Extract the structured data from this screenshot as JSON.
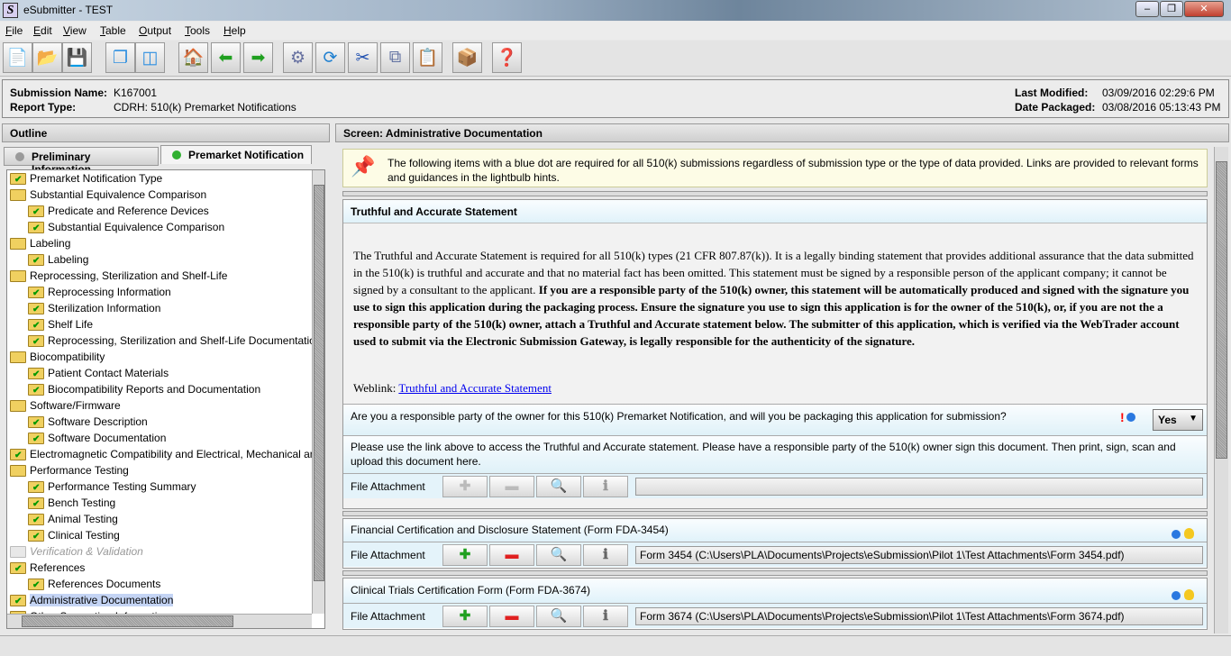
{
  "window": {
    "title": "eSubmitter - TEST",
    "icon_letter": "S"
  },
  "menu": [
    "File",
    "Edit",
    "View",
    "Table",
    "Output",
    "Tools",
    "Help"
  ],
  "toolbar": [
    "new-document-icon",
    "open-folder-icon",
    "save-icon",
    "cascade-windows-icon",
    "tile-windows-icon",
    "home-icon",
    "back-arrow-icon",
    "forward-arrow-icon",
    "gears-run-icon",
    "refresh-icon",
    "cut-icon",
    "copy-icon",
    "paste-icon",
    "package-icon",
    "help-icon"
  ],
  "info": {
    "submission_name_label": "Submission Name:",
    "submission_name": "K167001",
    "report_type_label": "Report Type:",
    "report_type": "CDRH: 510(k) Premarket Notifications",
    "last_modified_label": "Last Modified:",
    "last_modified": "03/09/2016 02:29:6 PM",
    "date_packaged_label": "Date Packaged:",
    "date_packaged": "03/08/2016 05:13:43 PM"
  },
  "outline": {
    "title": "Outline",
    "tabs": [
      {
        "label": "Preliminary Information",
        "color": "#9a9a9a"
      },
      {
        "label": "Premarket Notification",
        "color": "#30b030"
      }
    ],
    "tree": [
      {
        "label": "Premarket Notification Type",
        "level": 0
      },
      {
        "label": "Substantial Equivalence Comparison",
        "level": 0,
        "nocheck": true
      },
      {
        "label": "Predicate and Reference Devices",
        "level": 1
      },
      {
        "label": "Substantial Equivalence Comparison",
        "level": 1
      },
      {
        "label": "Labeling",
        "level": 0,
        "nocheck": true
      },
      {
        "label": "Labeling",
        "level": 1
      },
      {
        "label": "Reprocessing, Sterilization and Shelf-Life",
        "level": 0,
        "nocheck": true
      },
      {
        "label": "Reprocessing Information",
        "level": 1
      },
      {
        "label": "Sterilization Information",
        "level": 1
      },
      {
        "label": "Shelf Life",
        "level": 1
      },
      {
        "label": "Reprocessing, Sterilization and Shelf-Life Documentation",
        "level": 1
      },
      {
        "label": "Biocompatibility",
        "level": 0,
        "nocheck": true
      },
      {
        "label": "Patient Contact Materials",
        "level": 1
      },
      {
        "label": "Biocompatibility Reports and Documentation",
        "level": 1
      },
      {
        "label": "Software/Firmware",
        "level": 0,
        "nocheck": true
      },
      {
        "label": "Software Description",
        "level": 1
      },
      {
        "label": "Software Documentation",
        "level": 1
      },
      {
        "label": "Electromagnetic Compatibility and Electrical, Mechanical and Thermal Safety",
        "level": 0
      },
      {
        "label": "Performance Testing",
        "level": 0,
        "nocheck": true
      },
      {
        "label": "Performance Testing Summary",
        "level": 1
      },
      {
        "label": "Bench Testing",
        "level": 1
      },
      {
        "label": "Animal Testing",
        "level": 1
      },
      {
        "label": "Clinical Testing",
        "level": 1
      },
      {
        "label": "Verification & Validation",
        "level": 0,
        "disabled": true
      },
      {
        "label": "References",
        "level": 0
      },
      {
        "label": "References Documents",
        "level": 1
      },
      {
        "label": "Administrative Documentation",
        "level": 0,
        "selected": true
      },
      {
        "label": "Other Supporting Information",
        "level": 0
      }
    ]
  },
  "screen": {
    "title": "Screen: Administrative Documentation",
    "hint": "The following items with a blue dot are required for all 510(k) submissions regardless of submission type or the type of data provided.  Links are provided to relevant forms and guidances in the lightbulb hints.",
    "truthful": {
      "title": "Truthful and Accurate Statement",
      "body_plain": "The Truthful and Accurate Statement is required for all 510(k) types (21 CFR 807.87(k)). It is a legally binding statement that provides additional assurance that the data submitted in the 510(k) is truthful and accurate and that no material fact has been omitted. This statement must be signed by a responsible person of the applicant company; it cannot be signed by a consultant to the applicant. ",
      "body_bold": "If you are a responsible party of the 510(k) owner, this statement will be automatically produced and signed with the signature you use to sign this application during the packaging process. Ensure the signature you use to sign this application is for the owner of the 510(k), or, if you are not the a responsible party of the 510(k) owner, attach a Truthful and Accurate statement below. The submitter of this application, which is verified via the WebTrader account used to submit via the Electronic Submission Gateway, is legally responsible for the authenticity of the signature.",
      "weblink_label": "Weblink:",
      "weblink": "Truthful and Accurate Statement",
      "question": "Are you a responsible party of the owner for this 510(k) Premarket Notification, and will you be packaging this application for submission?",
      "answer": "Yes",
      "instructions": "Please use the link above to access the Truthful and Accurate statement.  Please have a responsible party of the 510(k) owner sign this document.  Then print, sign, scan and upload this document here.",
      "file_label": "File Attachment",
      "file_path": ""
    },
    "financial": {
      "title": "Financial Certification and Disclosure Statement (Form FDA-3454)",
      "file_label": "File Attachment",
      "file_path": "Form 3454 (C:\\Users\\PLA\\Documents\\Projects\\eSubmission\\Pilot 1\\Test Attachments\\Form 3454.pdf)"
    },
    "clinical": {
      "title": "Clinical Trials Certification Form (Form FDA-3674)",
      "file_label": "File Attachment",
      "file_path": "Form 3674 (C:\\Users\\PLA\\Documents\\Projects\\eSubmission\\Pilot 1\\Test Attachments\\Form 3674.pdf)"
    }
  },
  "colors": {
    "required_dot": "#2a78e0",
    "link": "#0000ee",
    "selected": "#c4d4f4"
  }
}
